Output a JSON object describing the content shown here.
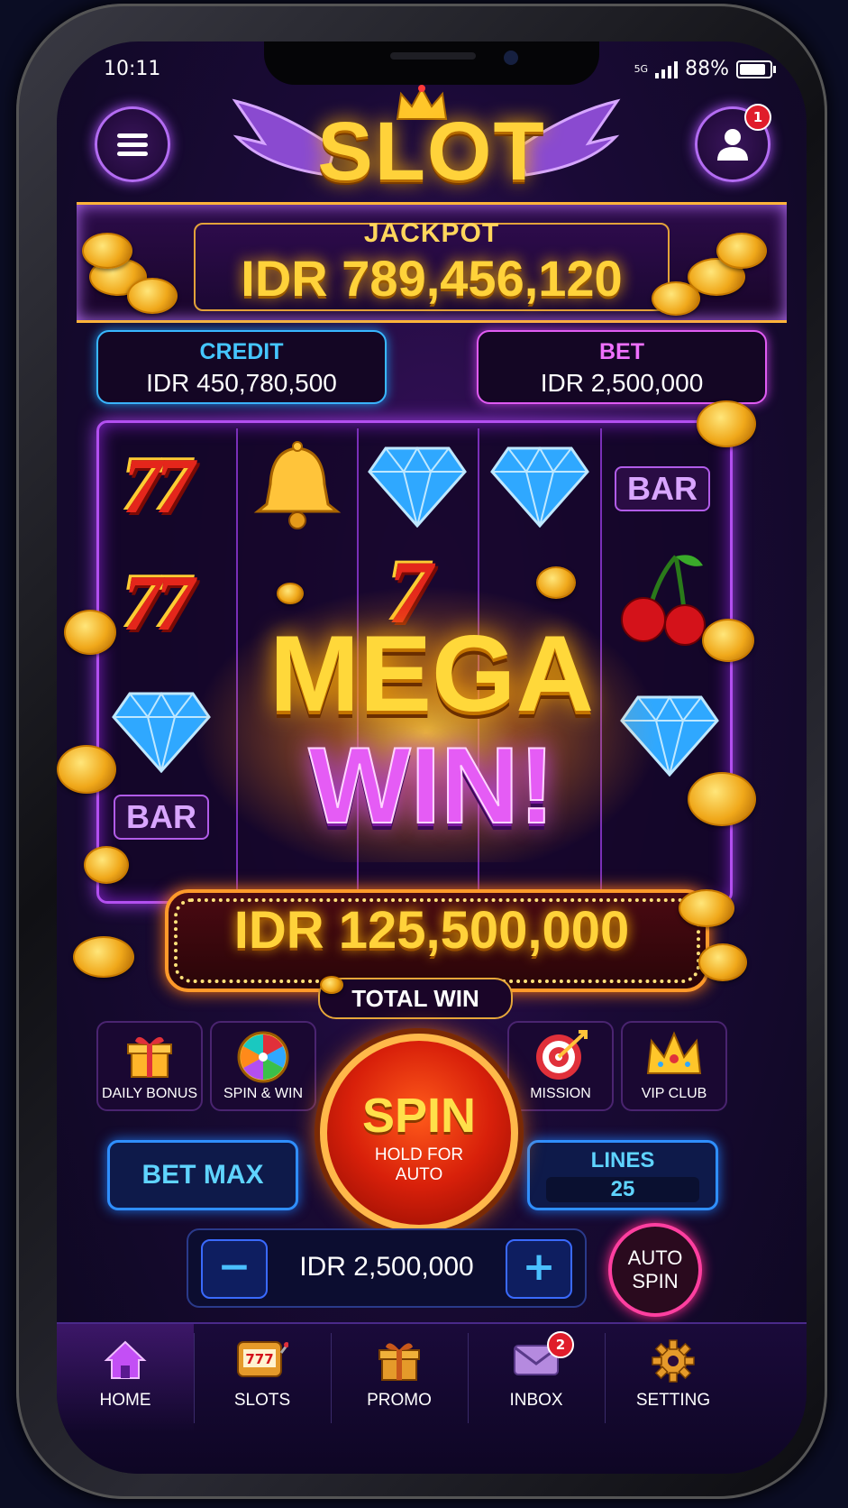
{
  "status_bar": {
    "time": "10:11",
    "battery": "88%",
    "network": "5G"
  },
  "header": {
    "logo_text": "SLOT",
    "profile_badge": "1",
    "icons": [
      "menu-icon",
      "crown-icon",
      "wings-icon",
      "user-icon"
    ]
  },
  "jackpot": {
    "label": "JACKPOT",
    "value": "IDR 789,456,120"
  },
  "credit": {
    "label": "CREDIT",
    "value": "IDR 450,780,500"
  },
  "bet": {
    "label": "BET",
    "value": "IDR 2,500,000"
  },
  "reels": {
    "symbols": [
      [
        "77",
        "77",
        "diamond",
        "BAR"
      ],
      [
        "bell"
      ],
      [
        "diamond",
        "7"
      ],
      [
        "diamond"
      ],
      [
        "BAR",
        "cherry",
        "diamond"
      ]
    ],
    "bar_label": "BAR"
  },
  "mega_win": {
    "line1": "MEGA",
    "line2": "WIN!",
    "amount": "IDR 125,500,000",
    "total_label": "TOTAL WIN"
  },
  "features": [
    {
      "label": "DAILY BONUS",
      "icon": "gift-icon"
    },
    {
      "label": "SPIN & WIN",
      "icon": "wheel-icon"
    },
    {
      "label": "MISSION",
      "icon": "target-icon"
    },
    {
      "label": "VIP CLUB",
      "icon": "crown-icon"
    }
  ],
  "spin": {
    "label": "SPIN",
    "sub": "HOLD FOR AUTO"
  },
  "controls": {
    "bet_max": "BET MAX",
    "lines_label": "LINES",
    "lines_value": "25",
    "bet_amount": "IDR 2,500,000",
    "minus": "−",
    "plus": "+",
    "auto_spin": "AUTO SPIN"
  },
  "nav": [
    {
      "label": "HOME",
      "icon": "home-icon",
      "active": true
    },
    {
      "label": "SLOTS",
      "icon": "slot-machine-icon"
    },
    {
      "label": "PROMO",
      "icon": "gift-icon"
    },
    {
      "label": "INBOX",
      "icon": "mail-icon",
      "badge": "2"
    },
    {
      "label": "SETTING",
      "icon": "gear-icon"
    }
  ],
  "colors": {
    "accent_gold": "#ffd23a",
    "accent_purple": "#b34ff0",
    "accent_blue": "#39b7ff",
    "accent_pink": "#e05cf2",
    "spin_red": "#d8200a"
  }
}
